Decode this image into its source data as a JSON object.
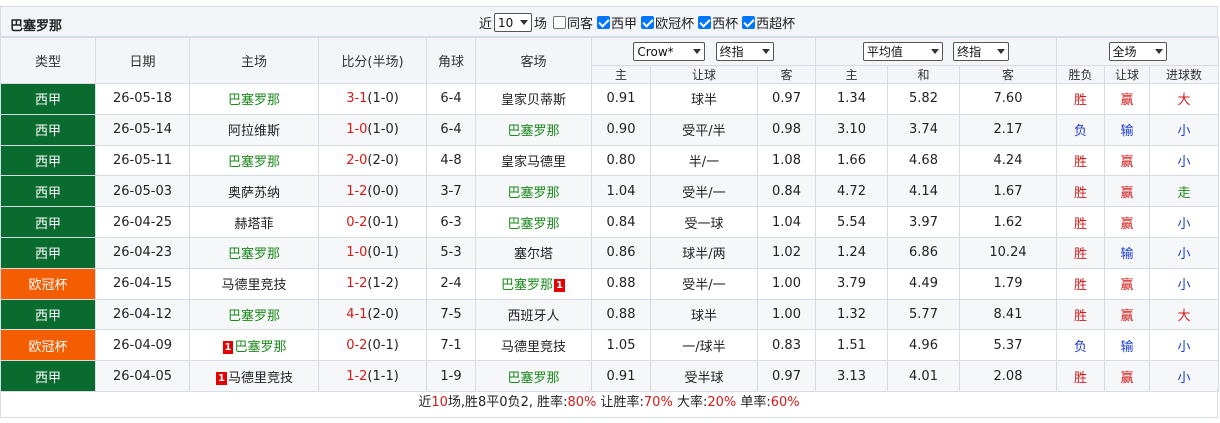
{
  "title": "巴塞罗那",
  "filters": {
    "near_label": "近",
    "count_value": "10",
    "unit_label": "场",
    "options": [
      {
        "label": "同客",
        "checked": false
      },
      {
        "label": "西甲",
        "checked": true
      },
      {
        "label": "欧冠杯",
        "checked": true
      },
      {
        "label": "西杯",
        "checked": true
      },
      {
        "label": "西超杯",
        "checked": true
      }
    ]
  },
  "headers": {
    "type": "类型",
    "date": "日期",
    "home": "主场",
    "score": "比分(半场)",
    "corner": "角球",
    "away": "客场",
    "company_select": "Crow*",
    "handicap_select": "终指",
    "avg_select": "平均值",
    "odds_select": "终指",
    "venue_select": "全场",
    "sub": {
      "home": "主",
      "line": "让球",
      "away": "客",
      "home2": "主",
      "draw": "和",
      "away2": "客",
      "result": "胜负",
      "ah": "让球",
      "goals": "进球数"
    }
  },
  "rows": [
    {
      "type": "西甲",
      "type_color": "green",
      "date": "26-05-18",
      "home": "巴塞罗那",
      "home_hl": true,
      "home_card": "",
      "score": "3-1",
      "half": "(1-0)",
      "score_color": "red",
      "corner": "6-4",
      "away": "皇家贝蒂斯",
      "away_hl": false,
      "away_card": "",
      "h": "0.91",
      "line": "球半",
      "a": "0.97",
      "o1": "1.34",
      "ox": "5.82",
      "o2": "7.60",
      "res": "胜",
      "res_color": "red",
      "ah": "赢",
      "ah_color": "red",
      "goals": "大",
      "goals_color": "red"
    },
    {
      "type": "西甲",
      "type_color": "green",
      "date": "26-05-14",
      "home": "阿拉维斯",
      "home_hl": false,
      "home_card": "",
      "score": "1-0",
      "half": "(1-0)",
      "score_color": "red",
      "corner": "6-4",
      "away": "巴塞罗那",
      "away_hl": true,
      "away_card": "",
      "h": "0.90",
      "line": "受平/半",
      "a": "0.98",
      "o1": "3.10",
      "ox": "3.74",
      "o2": "2.17",
      "res": "负",
      "res_color": "blue",
      "ah": "输",
      "ah_color": "blue",
      "goals": "小",
      "goals_color": "blue"
    },
    {
      "type": "西甲",
      "type_color": "green",
      "date": "26-05-11",
      "home": "巴塞罗那",
      "home_hl": true,
      "home_card": "",
      "score": "2-0",
      "half": "(2-0)",
      "score_color": "red",
      "corner": "4-8",
      "away": "皇家马德里",
      "away_hl": false,
      "away_card": "",
      "h": "0.80",
      "line": "半/一",
      "a": "1.08",
      "o1": "1.66",
      "ox": "4.68",
      "o2": "4.24",
      "res": "胜",
      "res_color": "red",
      "ah": "赢",
      "ah_color": "red",
      "goals": "小",
      "goals_color": "blue"
    },
    {
      "type": "西甲",
      "type_color": "green",
      "date": "26-05-03",
      "home": "奥萨苏纳",
      "home_hl": false,
      "home_card": "",
      "score": "1-2",
      "half": "(0-0)",
      "score_color": "red",
      "corner": "3-7",
      "away": "巴塞罗那",
      "away_hl": true,
      "away_card": "",
      "h": "1.04",
      "line": "受半/一",
      "a": "0.84",
      "o1": "4.72",
      "ox": "4.14",
      "o2": "1.67",
      "res": "胜",
      "res_color": "red",
      "ah": "赢",
      "ah_color": "red",
      "goals": "走",
      "goals_color": "green"
    },
    {
      "type": "西甲",
      "type_color": "green",
      "date": "26-04-25",
      "home": "赫塔菲",
      "home_hl": false,
      "home_card": "",
      "score": "0-2",
      "half": "(0-1)",
      "score_color": "red",
      "corner": "6-3",
      "away": "巴塞罗那",
      "away_hl": true,
      "away_card": "",
      "h": "0.84",
      "line": "受一球",
      "a": "1.04",
      "o1": "5.54",
      "ox": "3.97",
      "o2": "1.62",
      "res": "胜",
      "res_color": "red",
      "ah": "赢",
      "ah_color": "red",
      "goals": "小",
      "goals_color": "blue"
    },
    {
      "type": "西甲",
      "type_color": "green",
      "date": "26-04-23",
      "home": "巴塞罗那",
      "home_hl": true,
      "home_card": "",
      "score": "1-0",
      "half": "(0-1)",
      "score_color": "red",
      "corner": "5-3",
      "away": "塞尔塔",
      "away_hl": false,
      "away_card": "",
      "h": "0.86",
      "line": "球半/两",
      "a": "1.02",
      "o1": "1.24",
      "ox": "6.86",
      "o2": "10.24",
      "res": "胜",
      "res_color": "red",
      "ah": "输",
      "ah_color": "blue",
      "goals": "小",
      "goals_color": "blue"
    },
    {
      "type": "欧冠杯",
      "type_color": "orange",
      "date": "26-04-15",
      "home": "马德里竞技",
      "home_hl": false,
      "home_card": "",
      "score": "1-2",
      "half": "(1-2)",
      "score_color": "red",
      "corner": "2-4",
      "away": "巴塞罗那",
      "away_hl": true,
      "away_card": "1",
      "h": "0.88",
      "line": "受半/一",
      "a": "1.00",
      "o1": "3.79",
      "ox": "4.49",
      "o2": "1.79",
      "res": "胜",
      "res_color": "red",
      "ah": "赢",
      "ah_color": "red",
      "goals": "小",
      "goals_color": "blue"
    },
    {
      "type": "西甲",
      "type_color": "green",
      "date": "26-04-12",
      "home": "巴塞罗那",
      "home_hl": true,
      "home_card": "",
      "score": "4-1",
      "half": "(2-0)",
      "score_color": "red",
      "corner": "7-5",
      "away": "西班牙人",
      "away_hl": false,
      "away_card": "",
      "h": "0.88",
      "line": "球半",
      "a": "1.00",
      "o1": "1.32",
      "ox": "5.77",
      "o2": "8.41",
      "res": "胜",
      "res_color": "red",
      "ah": "赢",
      "ah_color": "red",
      "goals": "大",
      "goals_color": "red"
    },
    {
      "type": "欧冠杯",
      "type_color": "orange",
      "date": "26-04-09",
      "home": "巴塞罗那",
      "home_hl": true,
      "home_card": "1",
      "score": "0-2",
      "half": "(0-1)",
      "score_color": "red",
      "corner": "7-1",
      "away": "马德里竞技",
      "away_hl": false,
      "away_card": "",
      "h": "1.05",
      "line": "一/球半",
      "a": "0.83",
      "o1": "1.51",
      "ox": "4.96",
      "o2": "5.37",
      "res": "负",
      "res_color": "blue",
      "ah": "输",
      "ah_color": "blue",
      "goals": "小",
      "goals_color": "blue"
    },
    {
      "type": "西甲",
      "type_color": "green",
      "date": "26-04-05",
      "home": "马德里竞技",
      "home_hl": false,
      "home_card": "1",
      "score": "1-2",
      "half": "(1-1)",
      "score_color": "red",
      "corner": "1-9",
      "away": "巴塞罗那",
      "away_hl": true,
      "away_card": "",
      "h": "0.91",
      "line": "受半球",
      "a": "0.97",
      "o1": "3.13",
      "ox": "4.01",
      "o2": "2.08",
      "res": "胜",
      "res_color": "red",
      "ah": "赢",
      "ah_color": "red",
      "goals": "小",
      "goals_color": "blue"
    }
  ],
  "summary": {
    "prefix": "近",
    "count": "10",
    "text1": "场,胜8平0负2, 胜率:",
    "win_rate": "80%",
    "text2": " 让胜率:",
    "ah_rate": "70%",
    "text3": " 大率:",
    "over_rate": "20%",
    "text4": " 单率:",
    "odd_rate": "60%"
  },
  "colors": {
    "green": "#0a6b2f",
    "orange": "#f45d00",
    "red": "#d31a1a",
    "blue": "#1a3bd1",
    "highlight": "#1b8a1b"
  }
}
